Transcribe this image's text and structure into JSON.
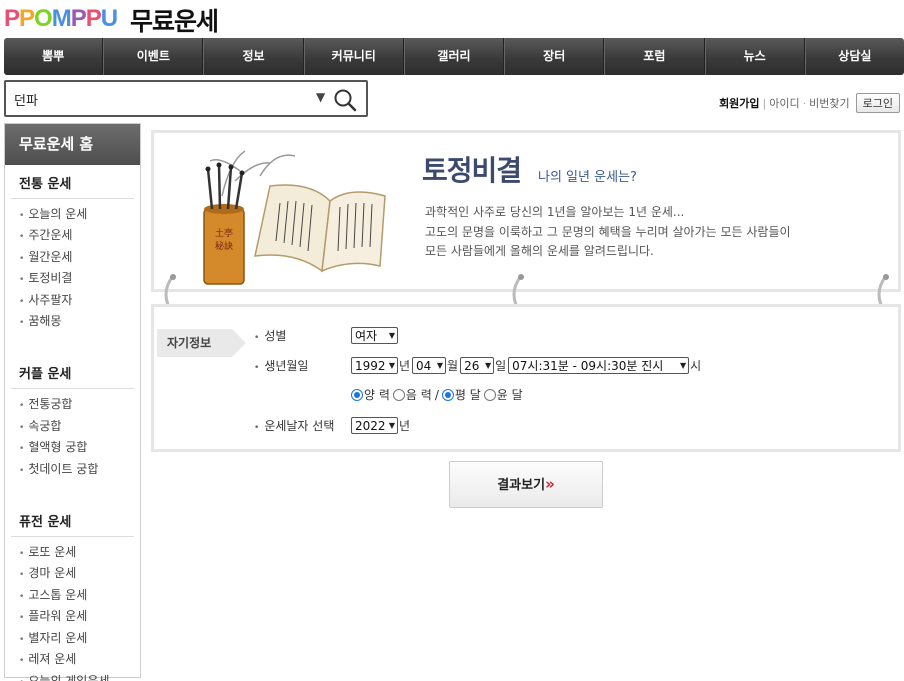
{
  "header": {
    "logo_text": "PPOMPPU",
    "site_title": "무료운세"
  },
  "nav": [
    "뽐뿌",
    "이벤트",
    "정보",
    "커뮤니티",
    "갤러리",
    "장터",
    "포럼",
    "뉴스",
    "상담실"
  ],
  "search": {
    "value": "던파",
    "dropdown_glyph": "▼"
  },
  "member": {
    "join": "회원가입",
    "id": "아이디",
    "pw": "비번찾기",
    "login": "로그인"
  },
  "sidebar": {
    "home": "무료운세 홈",
    "sections": [
      {
        "title": "전통 운세",
        "items": [
          "오늘의 운세",
          "주간운세",
          "월간운세",
          "토정비결",
          "사주팔자",
          "꿈해몽"
        ]
      },
      {
        "title": "커플 운세",
        "items": [
          "전통궁합",
          "속궁합",
          "혈액형 궁합",
          "첫데이트 궁합"
        ]
      },
      {
        "title": "퓨전 운세",
        "items": [
          "로또 운세",
          "경마 운세",
          "고스톱 운세",
          "플라워 운세",
          "별자리 운세",
          "레져 운세",
          "오늘의 게임운세"
        ]
      }
    ]
  },
  "banner": {
    "title": "토정비결",
    "subtitle": "나의 일년 운세는?",
    "desc": [
      "과학적인 사주로 당신의 1년을 알아보는 1년 운세...",
      "고도의 문명을 이룩하고 그 문명의 혜택을 누리며 살아가는 모든 사람들이",
      "모든 사람들에게 올해의 운세를 알려드립니다."
    ],
    "seal_text": "土亭秘訣"
  },
  "form": {
    "tag": "자기정보",
    "gender_label": "성별",
    "gender_value": "여자",
    "birth_label": "생년월일",
    "year": "1992",
    "year_unit": "년",
    "month": "04",
    "month_unit": "월",
    "day": "26",
    "day_unit": "일",
    "time": "07시:31분 - 09시:30분 진시",
    "time_unit": "시",
    "cal_solar": "양 력",
    "cal_lunar": "음 력",
    "cal_sep": "/",
    "month_normal": "평 달",
    "month_leap": "윤 달",
    "fortune_year_label": "운세날자 선택",
    "fortune_year": "2022",
    "fortune_year_unit": "년"
  },
  "result_button": {
    "label": "결과보기",
    "arrows": "»"
  },
  "colors": {
    "nav_bg": "#3a3a3a",
    "banner_title": "#3b4a6e",
    "accent_red": "#c8232c"
  }
}
